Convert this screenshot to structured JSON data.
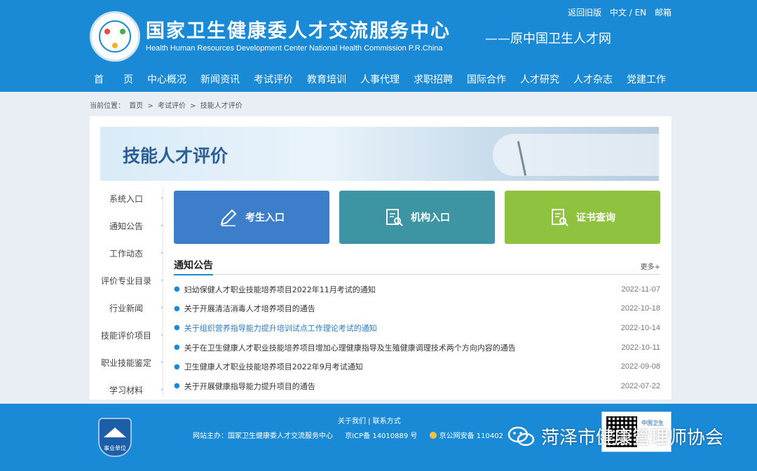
{
  "header": {
    "title": "国家卫生健康委人才交流服务中心",
    "subtitle": "Health Human Resources Development Center National Health Commission P.R.China",
    "former_name": "——原中国卫生人才网",
    "toplinks": {
      "old_version": "返回旧版",
      "language": "中文 / EN",
      "mail": "邮箱"
    }
  },
  "nav": [
    "首　　页",
    "中心概况",
    "新闻资讯",
    "考试评价",
    "教育培训",
    "人事代理",
    "求职招聘",
    "国际合作",
    "人才研究",
    "人才杂志",
    "党建工作"
  ],
  "breadcrumb": {
    "label": "当前位置：",
    "home": "首页",
    "sep": ">",
    "level1": "考试评价",
    "level2": "技能人才评价"
  },
  "banner": {
    "title": "技能人才评价"
  },
  "sidebar": [
    "系统入口",
    "通知公告",
    "工作动态",
    "评价专业目录",
    "行业新闻",
    "技能评价项目",
    "职业技能鉴定",
    "学习材料"
  ],
  "entries": {
    "candidate": "考生入口",
    "institution": "机构入口",
    "certificate": "证书查询"
  },
  "notices": {
    "title": "通知公告",
    "more": "更多+",
    "items": [
      {
        "text": "妇幼保健人才职业技能培养项目2022年11月考试的通知",
        "date": "2022-11-07"
      },
      {
        "text": "关于开展清洁消毒人才培养项目的通告",
        "date": "2022-10-18"
      },
      {
        "text": "关于组织营养指导能力提升培训试点工作理论考试的通知",
        "date": "2022-10-14"
      },
      {
        "text": "关于在卫生健康人才职业技能培养项目增加心理健康指导及生殖健康调理技术两个方向内容的通告",
        "date": "2022-10-11"
      },
      {
        "text": "卫生健康人才职业技能培养项目2022年9月考试通知",
        "date": "2022-09-08"
      },
      {
        "text": "关于开展健康指导能力提升项目的通告",
        "date": "2022-07-22"
      }
    ]
  },
  "footer": {
    "links": "关于我们 | 联系方式",
    "host": "网站主办：国家卫生健康委人才交流服务中心",
    "icp": "京ICP备 14010889 号",
    "police": "京公网安备 110402",
    "badge": "事业单位",
    "qr_label": "中国卫生"
  },
  "watermark": "菏泽市健康管理师协会",
  "colors": {
    "primary": "#1a8ad6",
    "candidate": "#3c7ec9",
    "institution": "#3d95a3",
    "certificate": "#8fc23f"
  }
}
